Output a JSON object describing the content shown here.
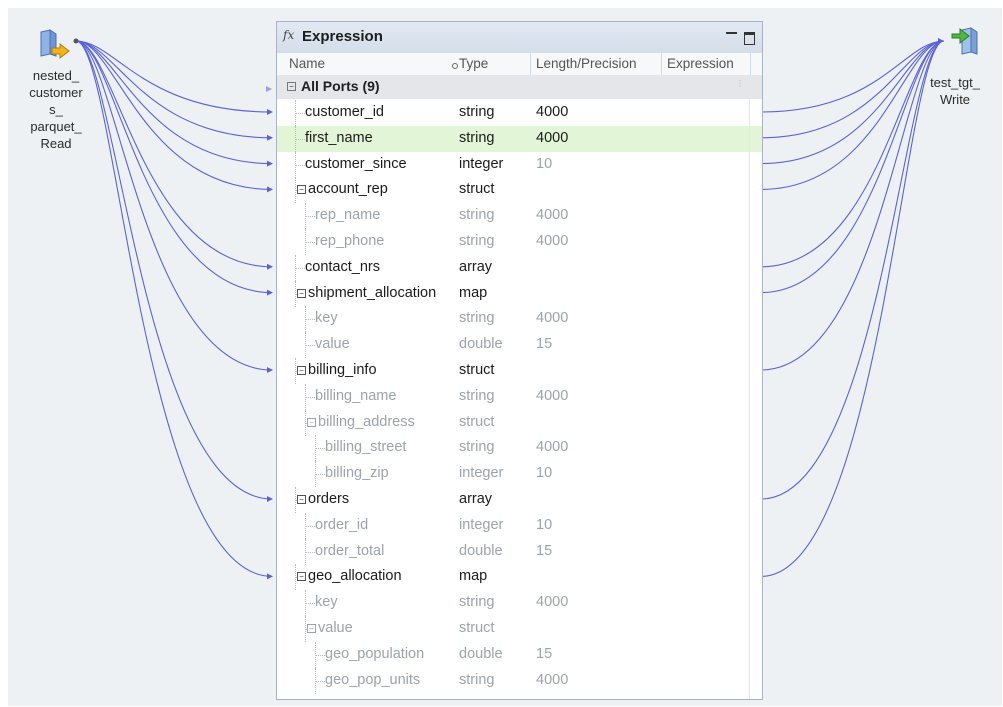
{
  "source": {
    "label": "nested_\ncustomer\ns_\nparquet_\nRead",
    "icon": "source-read-icon"
  },
  "target": {
    "label": "test_tgt_\nWrite",
    "icon": "target-write-icon"
  },
  "panel": {
    "title": "Expression",
    "icon": "fx-icon",
    "columns": {
      "name": "Name",
      "type": "Type",
      "length": "Length/Precision",
      "expression": "Expression"
    },
    "group_label": "All Ports (9)",
    "rows": [
      {
        "name": "customer_id",
        "type": "string",
        "length": "4000"
      },
      {
        "name": "first_name",
        "type": "string",
        "length": "4000"
      },
      {
        "name": "customer_since",
        "type": "integer",
        "length": "10"
      },
      {
        "name": "account_rep",
        "type": "struct",
        "length": ""
      },
      {
        "name": "rep_name",
        "type": "string",
        "length": "4000"
      },
      {
        "name": "rep_phone",
        "type": "string",
        "length": "4000"
      },
      {
        "name": "contact_nrs",
        "type": "array",
        "length": ""
      },
      {
        "name": "shipment_allocation",
        "type": "map",
        "length": ""
      },
      {
        "name": "key",
        "type": "string",
        "length": "4000"
      },
      {
        "name": "value",
        "type": "double",
        "length": "15"
      },
      {
        "name": "billing_info",
        "type": "struct",
        "length": ""
      },
      {
        "name": "billing_name",
        "type": "string",
        "length": "4000"
      },
      {
        "name": "billing_address",
        "type": "struct",
        "length": ""
      },
      {
        "name": "billing_street",
        "type": "string",
        "length": "4000"
      },
      {
        "name": "billing_zip",
        "type": "integer",
        "length": "10"
      },
      {
        "name": "orders",
        "type": "array",
        "length": ""
      },
      {
        "name": "order_id",
        "type": "integer",
        "length": "10"
      },
      {
        "name": "order_total",
        "type": "double",
        "length": "15"
      },
      {
        "name": "geo_allocation",
        "type": "map",
        "length": ""
      },
      {
        "name": "key",
        "type": "string",
        "length": "4000"
      },
      {
        "name": "value",
        "type": "struct",
        "length": ""
      },
      {
        "name": "geo_population",
        "type": "double",
        "length": "15"
      },
      {
        "name": "geo_pop_units",
        "type": "string",
        "length": "4000"
      }
    ]
  },
  "colors": {
    "wire": "#5a63d6",
    "selected_row": "#e2f5d6",
    "canvas": "#eef1f4"
  }
}
